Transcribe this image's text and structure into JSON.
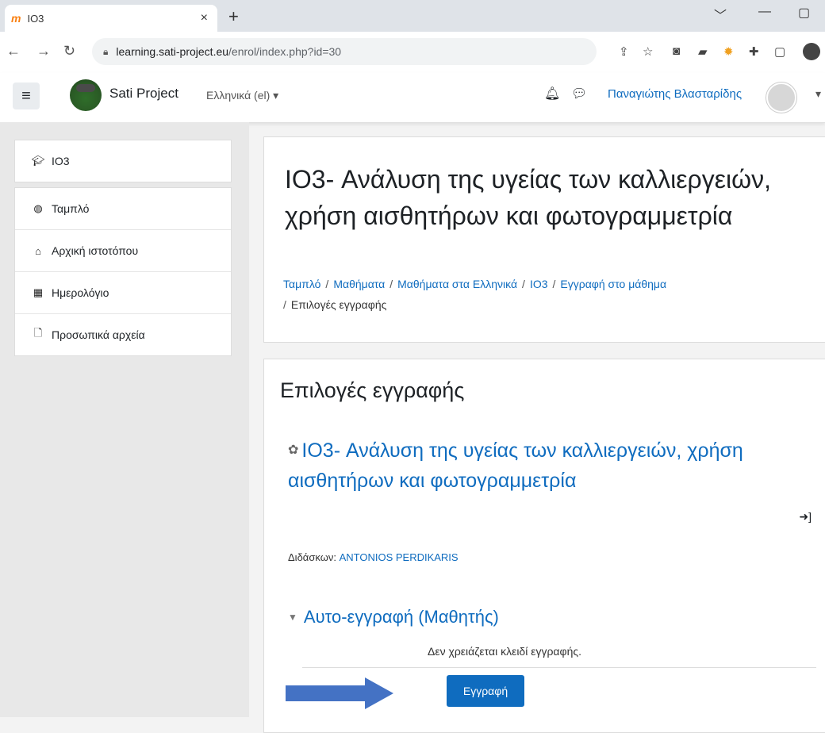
{
  "browser": {
    "tab_favicon": "m",
    "tab_title": "IO3",
    "tab_close": "×",
    "new_tab": "+",
    "url_host": "learning.sati-project.eu",
    "url_path": "/enrol/index.php?id=30",
    "window_buttons": [
      "﹀",
      "—",
      "▢"
    ]
  },
  "navbar": {
    "menu_icon": "≡",
    "site_name": "Sati Project",
    "language": "Ελληνικά (el) ▾",
    "user_name": "Παναγιώτης Βλασταρίδης",
    "user_menu_caret": "▾"
  },
  "drawer": {
    "course_item": {
      "icon": "graduation-cap-icon",
      "label": "IO3"
    },
    "items": [
      {
        "icon": "tachometer-icon",
        "label": "Ταμπλό"
      },
      {
        "icon": "home-icon",
        "label": "Αρχική ιστοτόπου"
      },
      {
        "icon": "calendar-icon",
        "label": "Ημερολόγιο"
      },
      {
        "icon": "file-icon",
        "label": "Προσωπικά αρχεία"
      }
    ]
  },
  "header": {
    "title": "IO3- Ανάλυση της υγείας των καλλιεργειών, χρήση αισθητήρων και φωτογραμμετρία",
    "breadcrumb": [
      "Ταμπλό",
      "Μαθήματα",
      "Μαθήματα στα Ελληνικά",
      "IO3",
      "Εγγραφή στο μάθημα"
    ],
    "breadcrumb_current": "Επιλογές εγγραφής",
    "breadcrumb_separator": "/"
  },
  "main": {
    "heading": "Επιλογές εγγραφής",
    "course_name": "IO3- Ανάλυση της υγείας των καλλιεργειών, χρήση αισθητήρων και φωτογραμμετρία",
    "teacher_label": "Διδάσκων:",
    "teacher_name": "ANTONIOS PERDIKARIS",
    "self_enrol_title": "Αυτο-εγγραφή (Μαθητής)",
    "no_key_text": "Δεν χρειάζεται κλειδί εγγραφής.",
    "enrol_button": "Εγγραφή"
  },
  "colors": {
    "link": "#0f6cbf",
    "button": "#0f6cbf",
    "annotation_arrow": "#4472c4"
  }
}
